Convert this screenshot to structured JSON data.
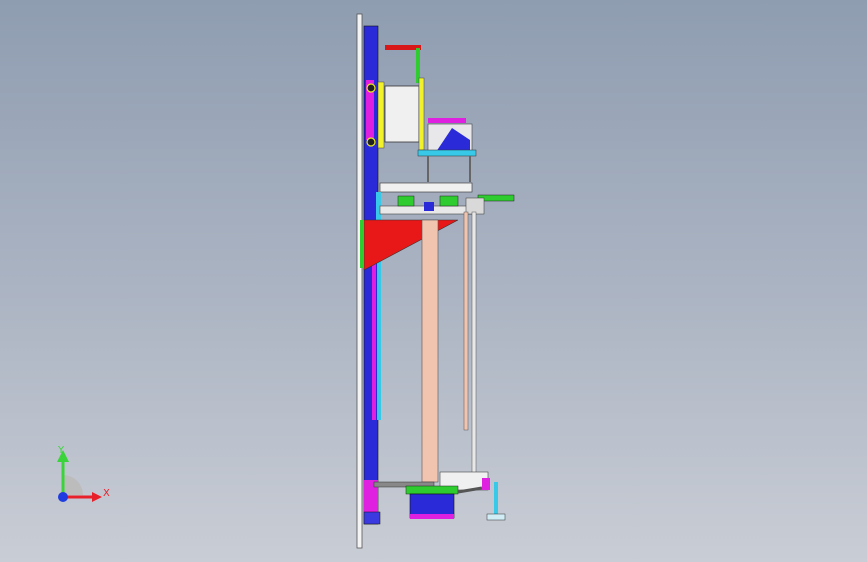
{
  "viewport": {
    "background_top": "#8f9db1",
    "background_bottom": "#c9cdd5"
  },
  "triad": {
    "x_label": "X",
    "y_label": "Y",
    "x_color": "#e8202a",
    "y_color": "#3ad43a",
    "z_color": "#1f3ce0"
  },
  "model": {
    "parts": [
      "frame-plate",
      "vertical-rail",
      "top-bracket",
      "motor-block",
      "gripper-assembly",
      "carriage-plate",
      "support-gusset",
      "lift-column",
      "guide-rod",
      "base-block",
      "foot-stand"
    ],
    "colors": {
      "frame": "#f2f2f2",
      "rail_blue": "#2a2ad8",
      "rail_magenta": "#e020e0",
      "accent_green": "#2ecc2e",
      "accent_red": "#e81818",
      "column": "#f1c4b0",
      "cyan": "#38c8e8",
      "yellow": "#f2f22a"
    }
  }
}
